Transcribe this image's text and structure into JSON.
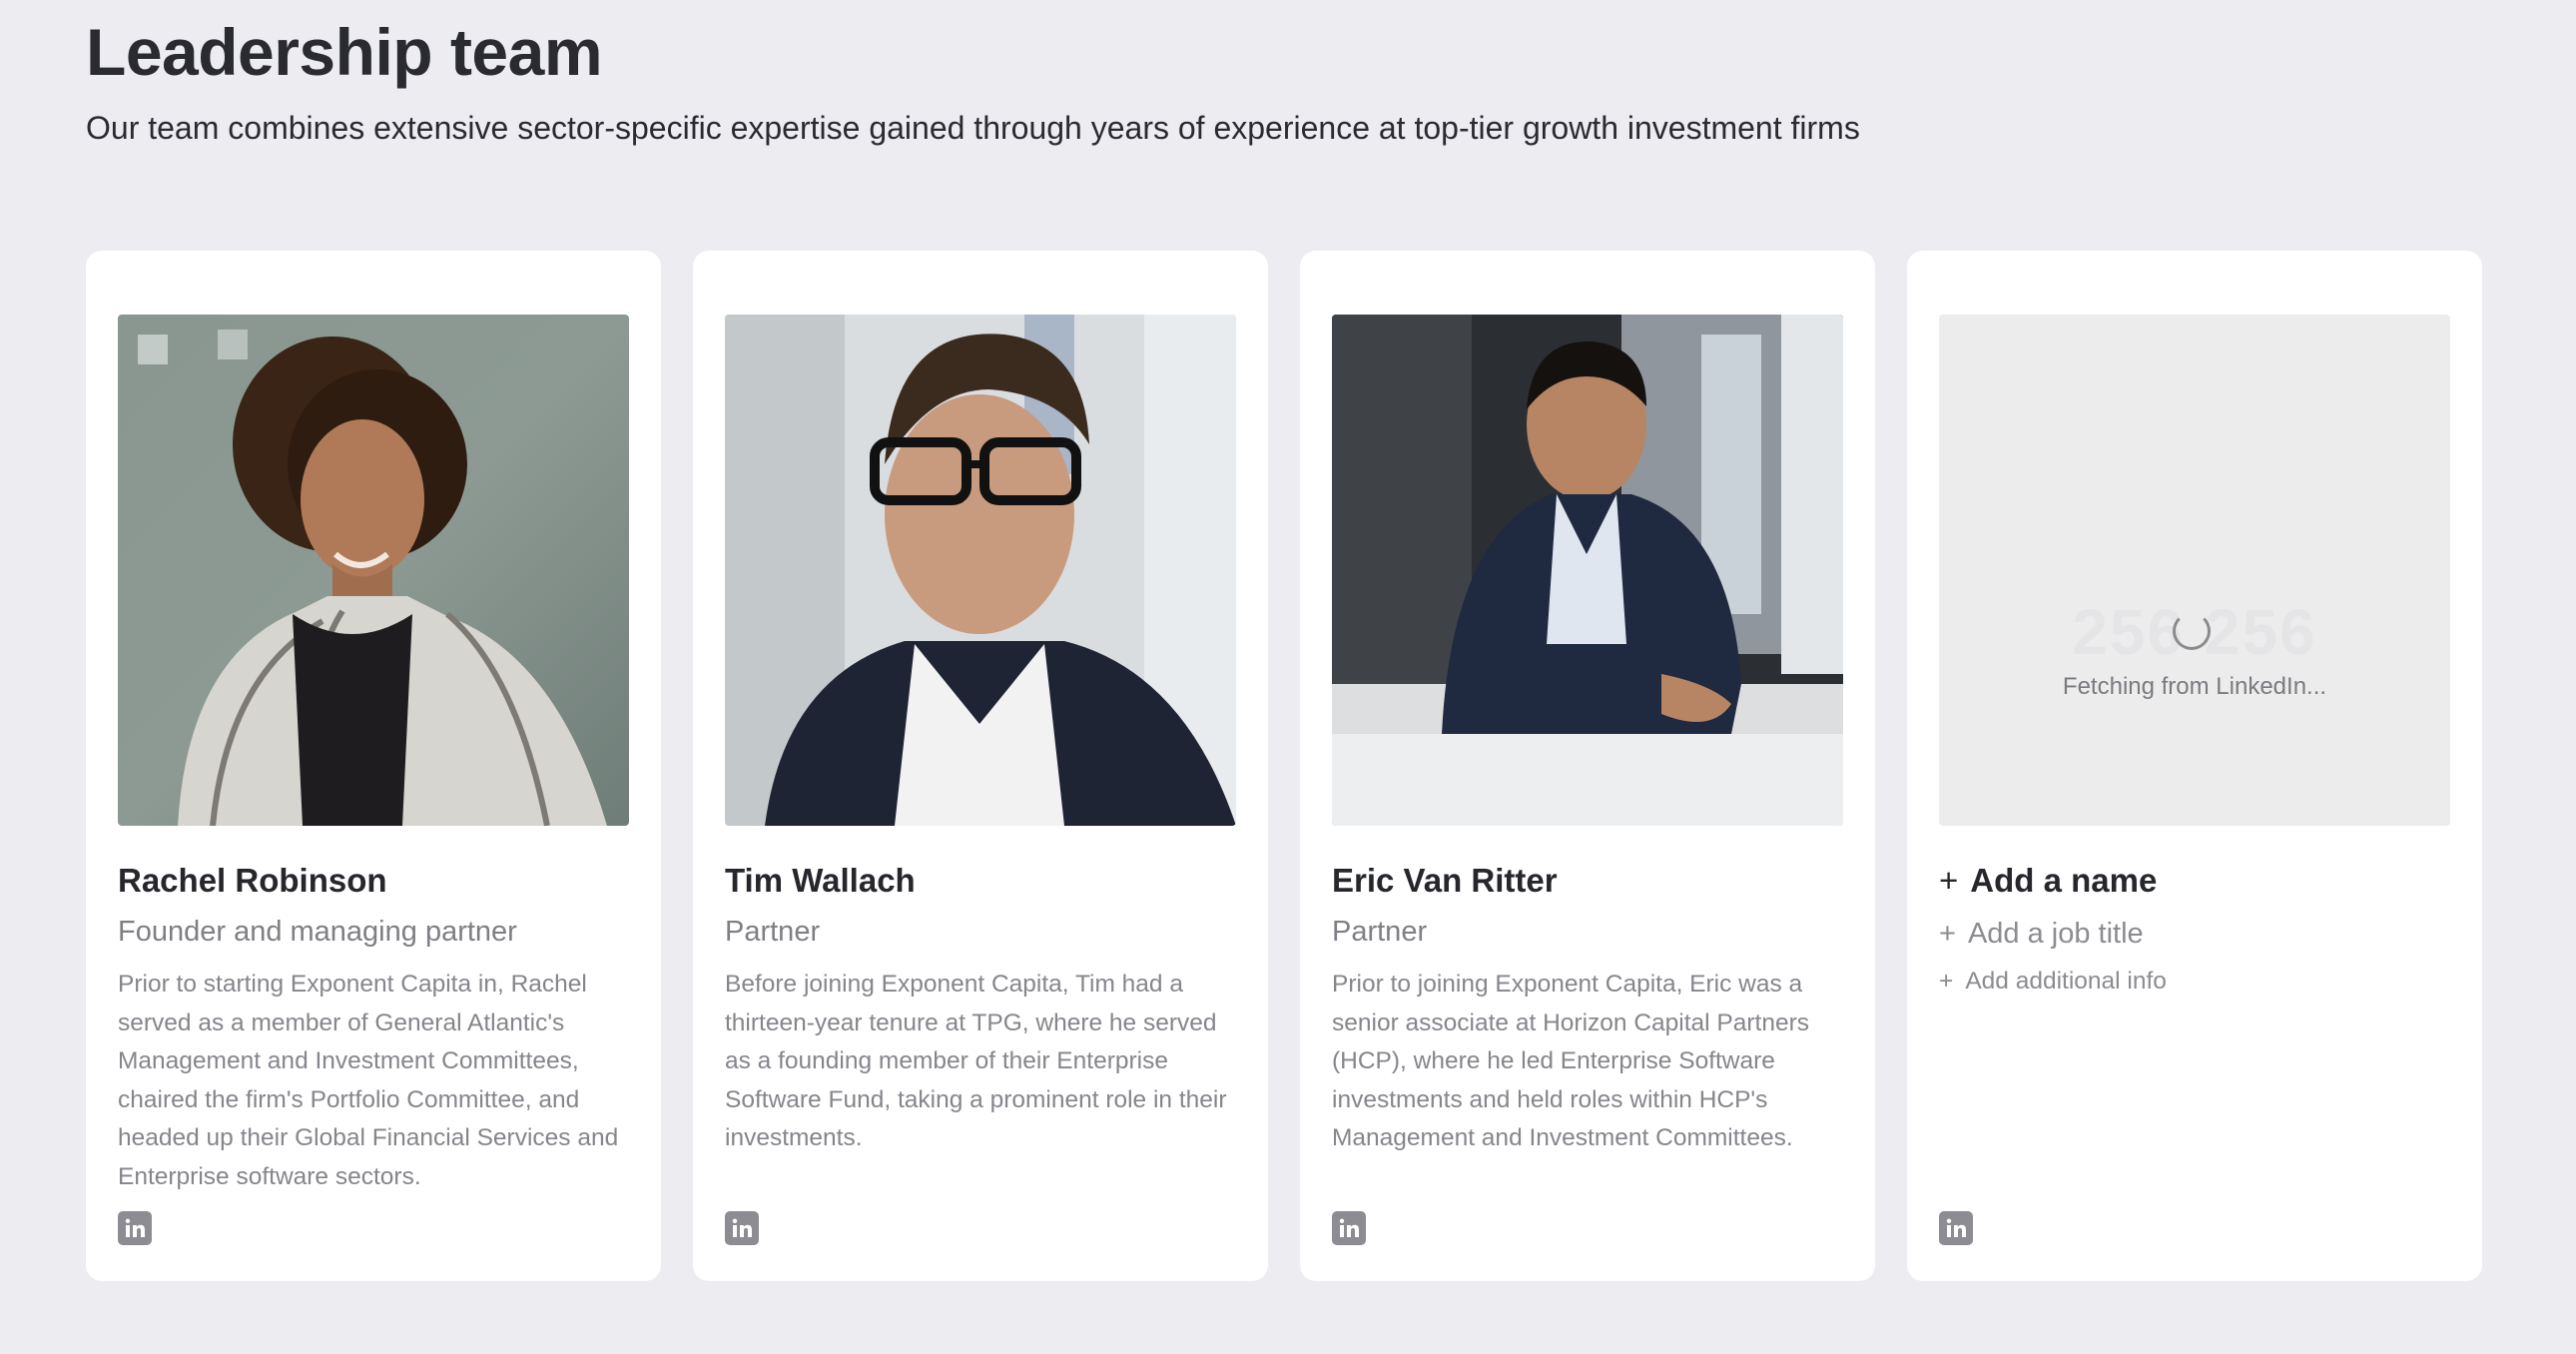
{
  "section": {
    "title": "Leadership team",
    "subtitle": "Our team combines extensive sector-specific expertise gained through years of experience at top-tier growth investment firms"
  },
  "members": [
    {
      "name": "Rachel Robinson",
      "role": "Founder and managing partner",
      "bio": "Prior to starting Exponent Capita in, Rachel served as a member of General Atlantic's Management and Investment Committees, chaired the firm's Portfolio Committee, and headed up their Global Financial Services and Enterprise software sectors.",
      "icon": "linkedin-icon"
    },
    {
      "name": "Tim Wallach",
      "role": "Partner",
      "bio": "Before joining Exponent Capita, Tim had a thirteen-year tenure at TPG, where he served as a founding member of their Enterprise Software Fund, taking a prominent role in their investments.",
      "icon": "linkedin-icon"
    },
    {
      "name": "Eric Van Ritter",
      "role": "Partner",
      "bio": "Prior to joining Exponent Capita, Eric was a senior associate at Horizon Capital Partners (HCP), where he led Enterprise Software investments and held roles within HCP's Management and Investment Committees.",
      "icon": "linkedin-icon"
    }
  ],
  "new_member": {
    "placeholder_dims": "256 256",
    "status": "Fetching from LinkedIn...",
    "plus": "+",
    "add_name": "Add a name",
    "add_job_title": "Add a job title",
    "add_info": "Add additional info",
    "icon": "linkedin-icon"
  },
  "colors": {
    "background": "#edecf1",
    "card": "#ffffff",
    "text_primary": "#26262c",
    "text_secondary": "#85858c",
    "icon": "#8c8c92"
  }
}
